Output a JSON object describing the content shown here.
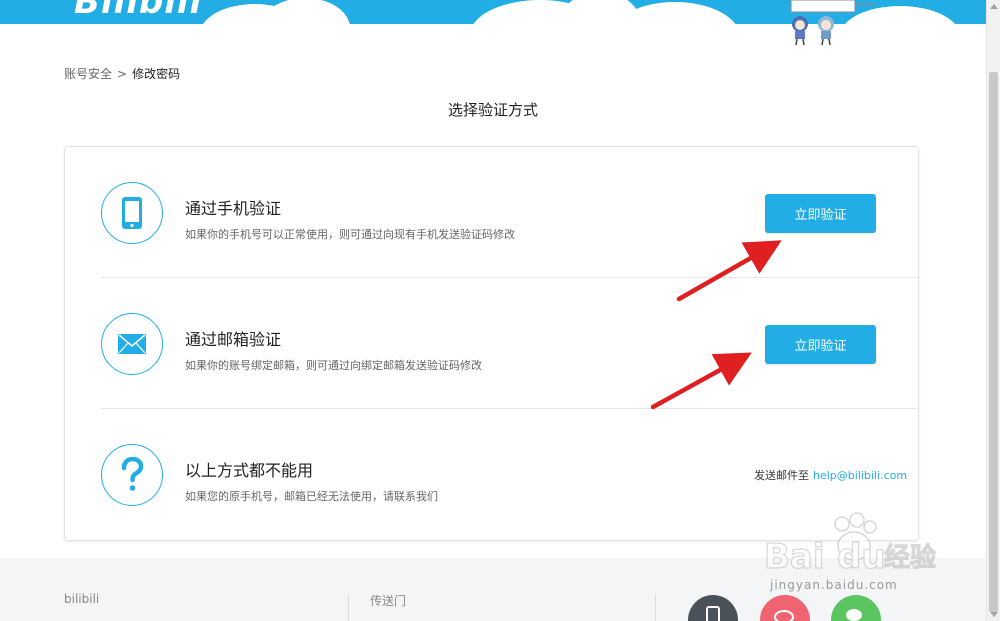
{
  "header": {
    "logo": "Bilibili"
  },
  "breadcrumb": {
    "parent": "账号安全",
    "separator": ">",
    "current": "修改密码"
  },
  "page_title": "选择验证方式",
  "options": [
    {
      "title": "通过手机验证",
      "desc": "如果你的手机号可以正常使用，则可通过向现有手机发送验证码修改",
      "button": "立即验证",
      "icon": "phone-icon"
    },
    {
      "title": "通过邮箱验证",
      "desc": "如果你的账号绑定邮箱，则可通过向绑定邮箱发送验证码修改",
      "button": "立即验证",
      "icon": "mail-icon"
    },
    {
      "title": "以上方式都不能用",
      "desc": "如果您的原手机号，邮箱已经无法使用，请联系我们",
      "contact_label": "发送邮件至",
      "contact_email": "help@bilibili.com",
      "icon": "question-icon"
    }
  ],
  "footer": {
    "col1": "bilibili",
    "col2": "传送门"
  },
  "watermark": {
    "text": "jingyan.baidu.com"
  },
  "colors": {
    "accent": "#23ade5",
    "arrow": "#e02020",
    "footer_bg": "#f4f5f7"
  }
}
